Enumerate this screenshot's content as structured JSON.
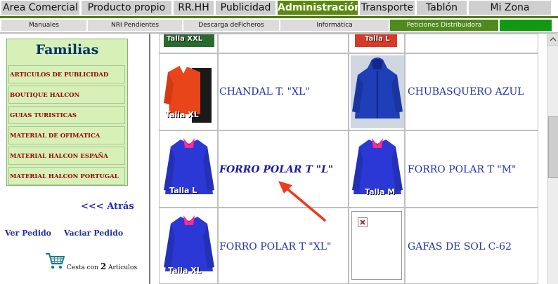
{
  "nav": {
    "tabs": [
      {
        "label": "Area Comercial",
        "active": false
      },
      {
        "label": "Producto propio",
        "active": false
      },
      {
        "label": "RR.HH",
        "active": false
      },
      {
        "label": "Publicidad",
        "active": false
      },
      {
        "label": "Administración",
        "active": true
      },
      {
        "label": "Transporte",
        "active": false
      },
      {
        "label": "Tablón",
        "active": false
      },
      {
        "label": "Mi Zona",
        "active": false
      }
    ],
    "subtabs": [
      {
        "label": "Manuales"
      },
      {
        "label": "NRI Pendientes"
      },
      {
        "label": "Descarga deFicheros"
      },
      {
        "label": "Informática"
      },
      {
        "label": "Peticiones Distribuidora"
      },
      {
        "label": ""
      }
    ]
  },
  "sidebar": {
    "title": "Familias",
    "items": [
      {
        "label": "ARTICULOS DE PUBLICIDAD"
      },
      {
        "label": "BOUTIQUE HALCON"
      },
      {
        "label": "GUIAS TURISTICAS"
      },
      {
        "label": "MATERIAL DE OFIMATICA"
      },
      {
        "label": "MATERIAL HALCON ESPAÑA"
      },
      {
        "label": "MATERIAL HALCON PORTUGAL"
      }
    ],
    "back": "<<< Atrás",
    "view_order": "Ver Pedido",
    "empty_order": "Vaciar Pedido",
    "cart": {
      "prefix": "Cesta con",
      "count": "2",
      "suffix": "Artículos"
    }
  },
  "products": {
    "top_labels": [
      "Talla XXL",
      "Talla L"
    ],
    "items": [
      {
        "name": "CHANDAL T. \"XL\"",
        "image_label": "Talla XL",
        "color": "#e8451a"
      },
      {
        "name": "CHUBASQUERO AZUL",
        "image_label": "",
        "color": "#1e3fb8"
      },
      {
        "name": "FORRO POLAR T \"L\"",
        "image_label": "Talla L",
        "color": "#2b38d6"
      },
      {
        "name": "FORRO POLAR T \"M\"",
        "image_label": "Talla M",
        "color": "#2b38d6"
      },
      {
        "name": "FORRO POLAR T \"XL\"",
        "image_label": "Talla XL",
        "color": "#2b38d6"
      },
      {
        "name": "GAFAS DE SOL C-62",
        "image_label": "",
        "color": ""
      }
    ]
  },
  "colors": {
    "nav_active": "#5a8a0c",
    "link": "#1f2fb0",
    "sidebar_bg": "#d6f0b8",
    "sidebar_text": "#990000"
  }
}
